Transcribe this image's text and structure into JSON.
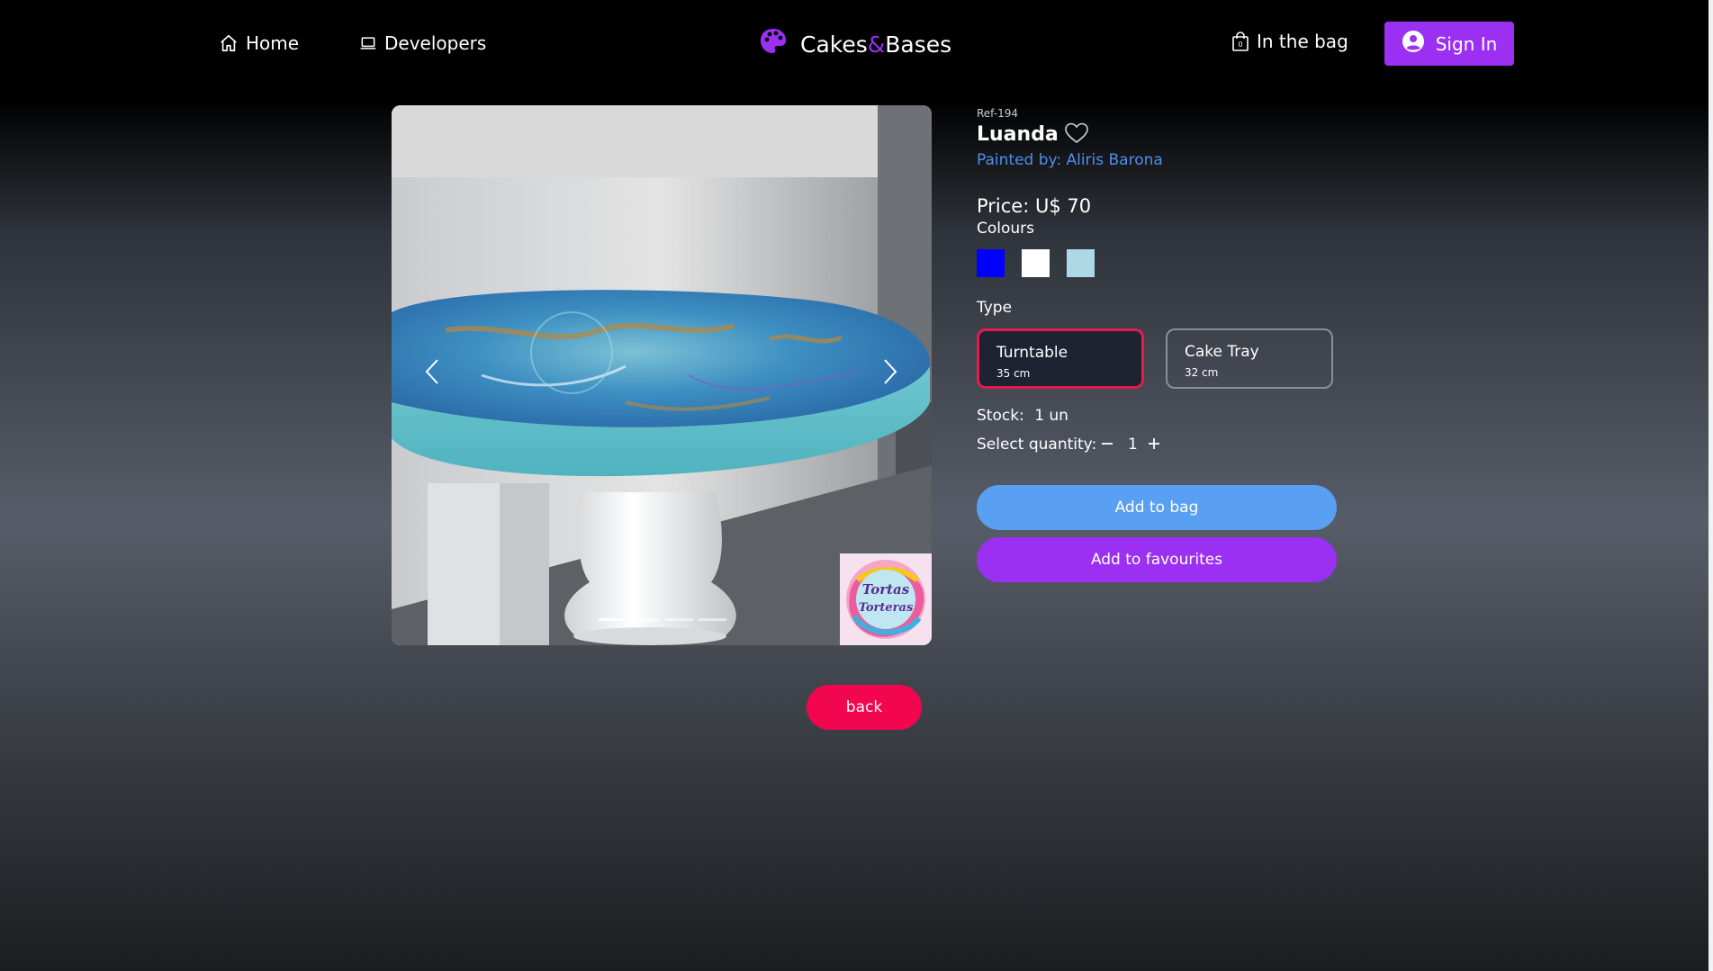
{
  "nav": {
    "home_label": "Home",
    "home_icon": "home-icon",
    "developers_label": "Developers",
    "developers_icon": "laptop-icon",
    "brand_part1": "Cakes",
    "brand_amp": "&",
    "brand_part2": "Bases",
    "brand_icon": "palette-icon",
    "bag_label": "In the bag",
    "bag_icon": "shopping-bag-icon",
    "signin_label": "Sign In",
    "signin_icon": "user-circle-icon"
  },
  "gallery": {
    "prev_icon": "chevron-left-icon",
    "next_icon": "chevron-right-icon",
    "slide_count": 4,
    "active_slide": 1,
    "logo_text_1": "Tortas",
    "logo_text_2": "Torteras"
  },
  "product": {
    "ref": "Ref-194",
    "name": "Luanda",
    "favourite_icon": "heart-outline-icon",
    "painter": "Painted by: Aliris Barona",
    "price": "Price: U$ 70",
    "colours_label": "Colours",
    "colours": [
      "#0000ff",
      "#ffffff",
      "#add8e6"
    ],
    "type_label": "Type",
    "types": [
      {
        "name": "Turntable",
        "size": "35 cm",
        "selected": true
      },
      {
        "name": "Cake Tray",
        "size": "32 cm",
        "selected": false
      }
    ],
    "stock_label": "Stock:",
    "stock_value": "1 un",
    "quantity_label": "Select quantity:",
    "quantity_value": "1",
    "minus_icon": "minus-icon",
    "plus_icon": "plus-icon",
    "add_to_bag": "Add to bag",
    "add_to_favourites": "Add to favourites",
    "back": "back"
  },
  "colors": {
    "accent_purple": "#9b30f2",
    "accent_blue": "#5aa0f2",
    "accent_red": "#f2064f",
    "link_blue": "#4f8fea"
  }
}
